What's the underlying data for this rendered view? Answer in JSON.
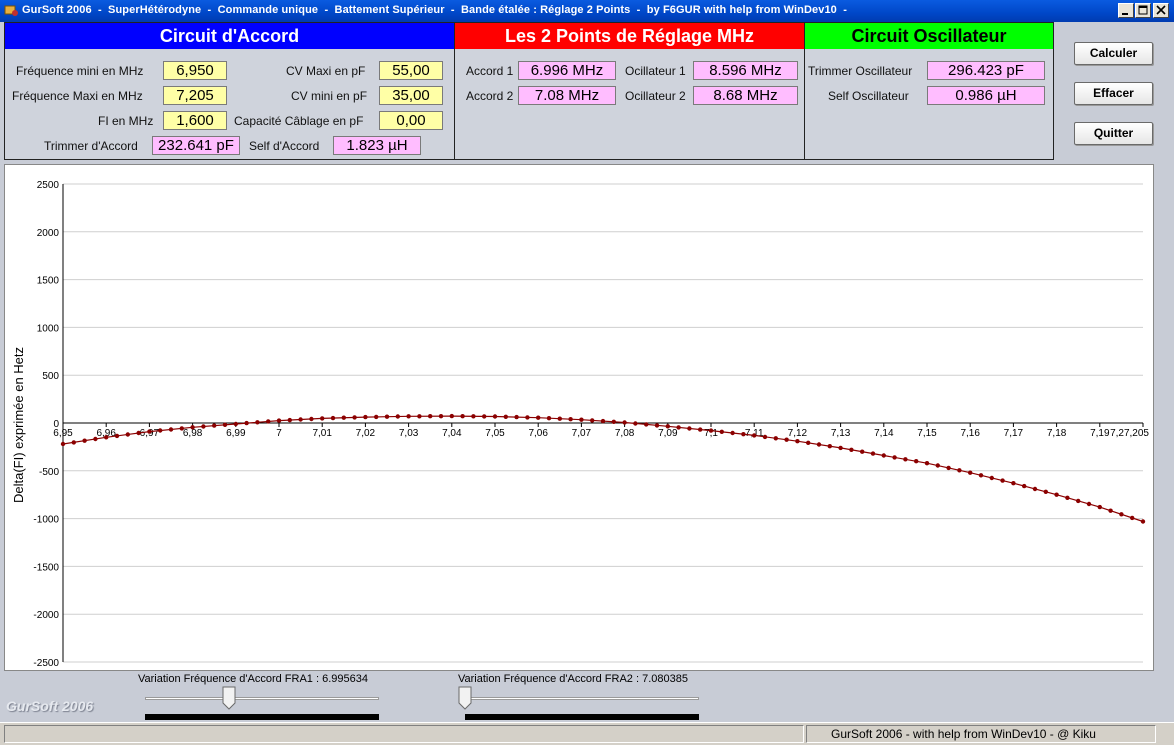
{
  "window": {
    "title": "GurSoft 2006  -  SuperHétérodyne  -  Commande unique  -  Battement Supérieur  -  Bande étalée : Réglage 2 Points  -  by F6GUR with help from WinDev10  -"
  },
  "accord": {
    "header": "Circuit d'Accord",
    "color": "#0000ff",
    "freq_min_label": "Fréquence mini en MHz",
    "freq_min_value": "6,950",
    "freq_max_label": "Fréquence Maxi en MHz",
    "freq_max_value": "7,205",
    "fi_label": "FI en MHz",
    "fi_value": "1,600",
    "cv_max_label": "CV Maxi en pF",
    "cv_max_value": "55,00",
    "cv_min_label": "CV mini en pF",
    "cv_min_value": "35,00",
    "cablage_label": "Capacité Câblage en pF",
    "cablage_value": "0,00",
    "trimmer_label": "Trimmer d'Accord",
    "trimmer_value": "232.641 pF",
    "self_label": "Self d'Accord",
    "self_value": "1.823 µH"
  },
  "points": {
    "header": "Les  2  Points de Réglage MHz",
    "color": "#ff0000",
    "accord1_label": "Accord 1",
    "accord1_value": "6.996 MHz",
    "accord2_label": "Accord 2",
    "accord2_value": "7.08 MHz",
    "osc1_label": "Ocillateur 1",
    "osc1_value": "8.596 MHz",
    "osc2_label": "Ocillateur 2",
    "osc2_value": "8.68 MHz"
  },
  "oscillateur": {
    "header": "Circuit Oscillateur",
    "color": "#00ff00",
    "trimmer_label": "Trimmer Oscillateur",
    "trimmer_value": "296.423 pF",
    "self_label": "Self Oscillateur",
    "self_value": "0.986 µH"
  },
  "buttons": {
    "calculer": "Calculer",
    "effacer": "Effacer",
    "quitter": "Quitter"
  },
  "chart_data": {
    "type": "line",
    "ylabel": "Delta(FI) exprimée en Hetz",
    "ylim": [
      -2500,
      2500
    ],
    "yticks": [
      2500,
      2000,
      1500,
      1000,
      500,
      0,
      -500,
      -1000,
      -1500,
      -2000,
      -2500
    ],
    "xtick_labels": [
      "6,95",
      "6,96",
      "6,97",
      "6,98",
      "6,99",
      "7",
      "7,01",
      "7,02",
      "7,03",
      "7,04",
      "7,05",
      "7,06",
      "7,07",
      "7,08",
      "7,09",
      "7,1",
      "7,11",
      "7,12",
      "7,13",
      "7,14",
      "7,15",
      "7,16",
      "7,17",
      "7,18",
      "7,19",
      "7,27,205"
    ],
    "xlim": [
      6.95,
      7.2
    ],
    "grid": "horizontal",
    "line_color": "#8b0000",
    "marker_color": "#8b0000",
    "curve_points": [
      [
        6.95,
        -220
      ],
      [
        6.96,
        -150
      ],
      [
        6.97,
        -90
      ],
      [
        6.98,
        -45
      ],
      [
        6.99,
        -10
      ],
      [
        7.0,
        25
      ],
      [
        7.01,
        48
      ],
      [
        7.02,
        62
      ],
      [
        7.03,
        70
      ],
      [
        7.04,
        72
      ],
      [
        7.05,
        68
      ],
      [
        7.06,
        55
      ],
      [
        7.07,
        35
      ],
      [
        7.08,
        5
      ],
      [
        7.09,
        -35
      ],
      [
        7.1,
        -80
      ],
      [
        7.11,
        -130
      ],
      [
        7.12,
        -190
      ],
      [
        7.13,
        -260
      ],
      [
        7.14,
        -340
      ],
      [
        7.15,
        -420
      ],
      [
        7.16,
        -520
      ],
      [
        7.17,
        -630
      ],
      [
        7.18,
        -750
      ],
      [
        7.19,
        -880
      ],
      [
        7.2,
        -1030
      ]
    ],
    "marker_spacing": 0.0025
  },
  "sliders": {
    "s1_label": "Variation Fréquence d'Accord  FRA1 : 6.995634",
    "s1_fraction": 0.36,
    "s2_label": "Variation Fréquence d'Accord  FRA2 : 7.080385",
    "s2_fraction": 0.0
  },
  "watermark": "GurSoft 2006",
  "status": {
    "right": "GurSoft 2006  -  with help from WinDev10  -  @ Kiku"
  }
}
